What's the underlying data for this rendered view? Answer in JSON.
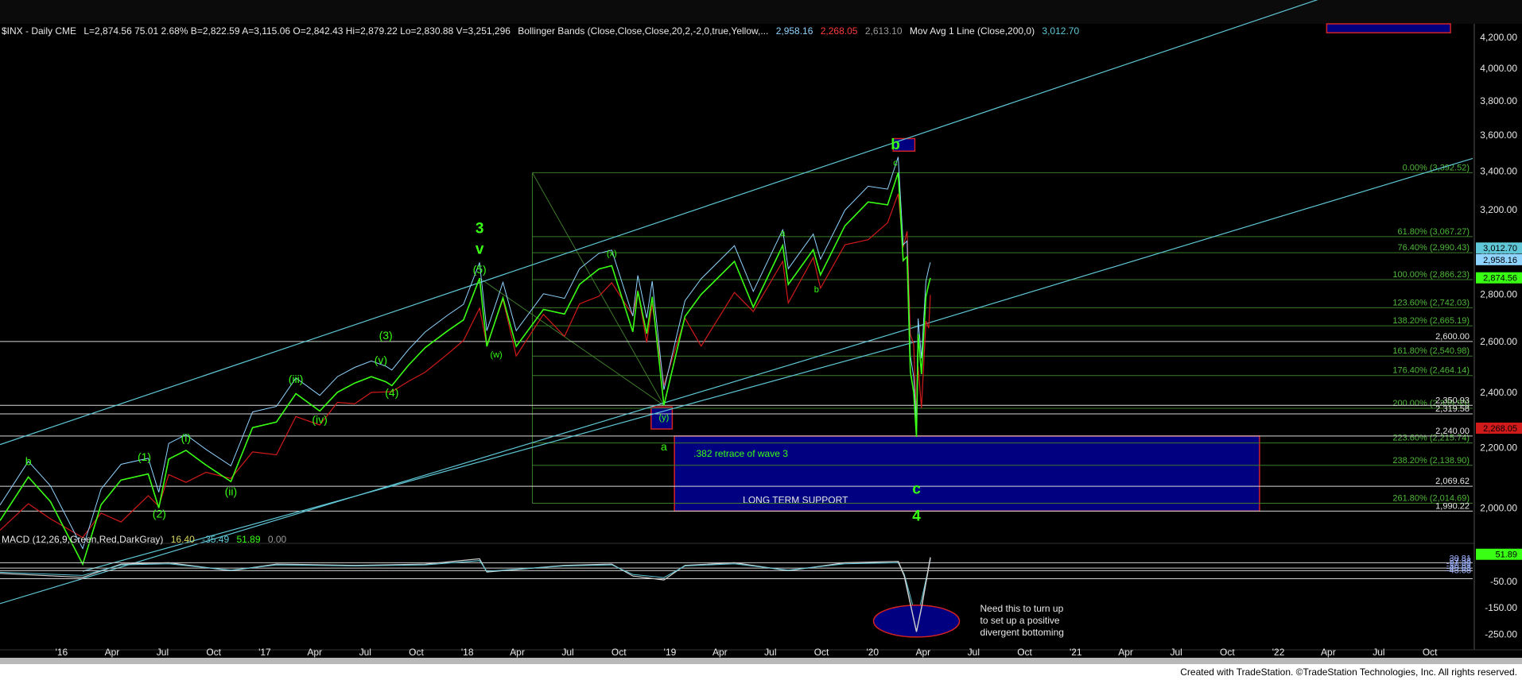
{
  "header": {
    "symbol": "$INX - Daily  CME",
    "quote": "L=2,874.56  75.01  2.68%  B=2,822.59  A=3,115.06  O=2,842.43  Hi=2,879.22  Lo=2,830.88  V=3,251,296",
    "bb_label": "Bollinger Bands (Close,Close,Close,20,2,-2,0,true,Yellow,...",
    "bb_values": [
      "2,958.16",
      "2,268.05",
      "2,613.10"
    ],
    "ma_label": "Mov Avg 1 Line (Close,200,0)",
    "ma_value": "3,012.70"
  },
  "macd_header": {
    "label": "MACD (12,26,9,Green,Red,DarkGray)",
    "values": [
      "16.40",
      "-35.49",
      "51.89",
      "0.00"
    ]
  },
  "footer": "Created with TradeStation. ©TradeStation Technologies, Inc. All rights reserved.",
  "colors": {
    "price": "#39ff14",
    "bb": "#8fd3ff",
    "ma_red": "#d11a1a",
    "channel": "#5fc7d6",
    "fib": "#3d7a2a",
    "box_fill": "#000080",
    "box_border": "#d22222",
    "label_green": "#39ff14",
    "axis_text": "#e8e8e8"
  },
  "chart_data": [
    {
      "type": "line",
      "title": "$INX - Daily",
      "y_axis": {
        "ticks": [
          2000,
          2200,
          2400,
          2600,
          2800,
          3000,
          3200,
          3400,
          3600,
          3800,
          4000,
          4200
        ],
        "tick_labels": [
          "2,000.00",
          "2,200.00",
          "2,400.00",
          "2,600.00",
          "2,800.00",
          "3,000.00",
          "3,200.00",
          "3,400.00",
          "3,600.00",
          "3,800.00",
          "4,000.00",
          "4,200.00"
        ],
        "ylim": [
          1920,
          4290
        ],
        "scale": "log"
      },
      "x_axis": {
        "tick_labels": [
          "'16",
          "Apr",
          "Jul",
          "Oct",
          "'17",
          "Apr",
          "Jul",
          "Oct",
          "'18",
          "Apr",
          "Jul",
          "Oct",
          "'19",
          "Apr",
          "Jul",
          "Oct",
          "'20",
          "Apr",
          "Jul",
          "Oct",
          "'21",
          "Apr",
          "Jul",
          "Oct",
          "'22",
          "Apr",
          "Jul",
          "Oct"
        ],
        "tick_dates": [
          "2016-01",
          "2016-04",
          "2016-07",
          "2016-10",
          "2017-01",
          "2017-04",
          "2017-07",
          "2017-10",
          "2018-01",
          "2018-04",
          "2018-07",
          "2018-10",
          "2019-01",
          "2019-04",
          "2019-07",
          "2019-10",
          "2020-01",
          "2020-04",
          "2020-07",
          "2020-10",
          "2021-01",
          "2021-04",
          "2021-07",
          "2021-10",
          "2022-01",
          "2022-04",
          "2022-07",
          "2022-10"
        ],
        "xlim": [
          "2015-09-15",
          "2022-12-20"
        ]
      },
      "series": [
        {
          "name": "$INX",
          "points": [
            [
              "2015-09-15",
              1960
            ],
            [
              "2015-11-05",
              2100
            ],
            [
              "2015-12-15",
              2020
            ],
            [
              "2016-02-11",
              1830
            ],
            [
              "2016-03-15",
              2010
            ],
            [
              "2016-04-20",
              2090
            ],
            [
              "2016-06-08",
              2110
            ],
            [
              "2016-06-27",
              2000
            ],
            [
              "2016-07-15",
              2160
            ],
            [
              "2016-08-15",
              2190
            ],
            [
              "2016-09-20",
              2140
            ],
            [
              "2016-11-04",
              2085
            ],
            [
              "2016-12-13",
              2270
            ],
            [
              "2017-01-25",
              2290
            ],
            [
              "2017-03-01",
              2395
            ],
            [
              "2017-04-13",
              2330
            ],
            [
              "2017-05-15",
              2400
            ],
            [
              "2017-06-15",
              2435
            ],
            [
              "2017-07-15",
              2460
            ],
            [
              "2017-08-10",
              2440
            ],
            [
              "2017-08-21",
              2425
            ],
            [
              "2017-09-20",
              2505
            ],
            [
              "2017-10-20",
              2575
            ],
            [
              "2017-11-30",
              2645
            ],
            [
              "2017-12-28",
              2690
            ],
            [
              "2018-01-26",
              2873
            ],
            [
              "2018-02-08",
              2580
            ],
            [
              "2018-03-09",
              2785
            ],
            [
              "2018-04-02",
              2580
            ],
            [
              "2018-05-21",
              2735
            ],
            [
              "2018-06-28",
              2715
            ],
            [
              "2018-07-25",
              2845
            ],
            [
              "2018-08-29",
              2915
            ],
            [
              "2018-09-21",
              2930
            ],
            [
              "2018-10-29",
              2640
            ],
            [
              "2018-11-07",
              2815
            ],
            [
              "2018-11-23",
              2632
            ],
            [
              "2018-12-03",
              2790
            ],
            [
              "2018-12-24",
              2351
            ],
            [
              "2019-01-31",
              2705
            ],
            [
              "2019-03-01",
              2800
            ],
            [
              "2019-04-30",
              2950
            ],
            [
              "2019-06-03",
              2745
            ],
            [
              "2019-07-26",
              3025
            ],
            [
              "2019-08-05",
              2845
            ],
            [
              "2019-09-19",
              3005
            ],
            [
              "2019-10-02",
              2888
            ],
            [
              "2019-11-15",
              3120
            ],
            [
              "2019-12-27",
              3240
            ],
            [
              "2020-01-31",
              3225
            ],
            [
              "2020-02-19",
              3393
            ],
            [
              "2020-02-28",
              2954
            ],
            [
              "2020-03-06",
              2972
            ],
            [
              "2020-03-12",
              2480
            ],
            [
              "2020-03-18",
              2400
            ],
            [
              "2020-03-23",
              2237
            ],
            [
              "2020-03-26",
              2630
            ],
            [
              "2020-04-01",
              2470
            ],
            [
              "2020-04-09",
              2790
            ],
            [
              "2020-04-14",
              2846
            ],
            [
              "2020-04-17",
              2874
            ]
          ]
        }
      ],
      "horizontal_lines": [
        {
          "label": "2,600.00",
          "value": 2600
        },
        {
          "label": "2,350.93",
          "value": 2350.93
        },
        {
          "label": "2,319.58",
          "value": 2319.58
        },
        {
          "label": "2,240.00",
          "value": 2240
        },
        {
          "label": "2,069.62",
          "value": 2069.62
        },
        {
          "label": "1,990.22",
          "value": 1990.22
        }
      ],
      "fib_levels": [
        {
          "label": "0.00% (3,392.52)",
          "value": 3392.52
        },
        {
          "label": "61.80% (3,067.27)",
          "value": 3067.27
        },
        {
          "label": "76.40% (2,990.43)",
          "value": 2990.43
        },
        {
          "label": "100.00% (2,866.23)",
          "value": 2866.23
        },
        {
          "label": "123.60% (2,742.03)",
          "value": 2742.03
        },
        {
          "label": "138.20% (2,665.19)",
          "value": 2665.19
        },
        {
          "label": "161.80% (2,540.98)",
          "value": 2540.98
        },
        {
          "label": "176.40% (2,464.14)",
          "value": 2464.14
        },
        {
          "label": "200.00% (2,339.93)",
          "value": 2339.93
        },
        {
          "label": "223.60% (2,215.74)",
          "value": 2215.74
        },
        {
          "label": "238.20% (2,138.90)",
          "value": 2138.9
        },
        {
          "label": "261.80% (2,014.69)",
          "value": 2014.69
        }
      ],
      "price_tags": [
        {
          "text": "3,012.70",
          "value": 3012.7,
          "bg": "#5fc7d6"
        },
        {
          "text": "2,958.16",
          "value": 2958.16,
          "bg": "#8fd3ff"
        },
        {
          "text": "2,874.56",
          "value": 2874.56,
          "bg": "#39ff14"
        },
        {
          "text": "2,268.05",
          "value": 2268.05,
          "bg": "#d11a1a"
        }
      ],
      "boxes": [
        {
          "name": "long-term-support",
          "x": [
            "2019-01-12",
            "2021-12-01"
          ],
          "y": [
            1990.22,
            2240
          ],
          "label": "LONG TERM SUPPORT",
          "sublabel": ".382 retrace of wave 3"
        },
        {
          "name": "wave-b-target",
          "x": [
            "2020-02-10",
            "2020-03-20"
          ],
          "y": [
            3510,
            3580
          ]
        },
        {
          "name": "wave-y-box",
          "x": [
            "2018-12-01",
            "2019-01-08"
          ],
          "y": [
            2265,
            2345
          ]
        },
        {
          "name": "top-box",
          "x": [
            "2022-04-01",
            "2022-11-10"
          ],
          "y": [
            4230,
            4290
          ]
        }
      ],
      "wave_labels": [
        {
          "text": "b",
          "date": "2015-11-05",
          "value": 2140,
          "size": "m"
        },
        {
          "text": "(1)",
          "date": "2016-06-01",
          "value": 2155,
          "size": "m"
        },
        {
          "text": "(2)",
          "date": "2016-06-28",
          "value": 1970,
          "size": "m"
        },
        {
          "text": "(i)",
          "date": "2016-08-15",
          "value": 2220,
          "size": "m"
        },
        {
          "text": "(ii)",
          "date": "2016-11-04",
          "value": 2040,
          "size": "m"
        },
        {
          "text": "(iii)",
          "date": "2017-03-01",
          "value": 2435,
          "size": "m"
        },
        {
          "text": "(iv)",
          "date": "2017-04-13",
          "value": 2285,
          "size": "m"
        },
        {
          "text": "(v)",
          "date": "2017-08-01",
          "value": 2510,
          "size": "m"
        },
        {
          "text": "(3)",
          "date": "2017-08-10",
          "value": 2610,
          "size": "m"
        },
        {
          "text": "(4)",
          "date": "2017-08-21",
          "value": 2385,
          "size": "m"
        },
        {
          "text": "(5)",
          "date": "2018-01-26",
          "value": 2895,
          "size": "m"
        },
        {
          "text": "v",
          "date": "2018-01-26",
          "value": 2985,
          "size": "l"
        },
        {
          "text": "3",
          "date": "2018-01-26",
          "value": 3085,
          "size": "l"
        },
        {
          "text": "(w)",
          "date": "2018-02-25",
          "value": 2535,
          "size": "s"
        },
        {
          "text": "(x)",
          "date": "2018-09-21",
          "value": 2975,
          "size": "s"
        },
        {
          "text": "(y)",
          "date": "2018-12-24",
          "value": 2297,
          "size": "s"
        },
        {
          "text": "a",
          "date": "2018-12-24",
          "value": 2190,
          "size": "m"
        },
        {
          "text": "a",
          "date": "2019-07-26",
          "value": 3070,
          "size": "s"
        },
        {
          "text": "b",
          "date": "2019-09-25",
          "value": 2810,
          "size": "s"
        },
        {
          "text": "b",
          "date": "2020-02-14",
          "value": 3520,
          "size": "l"
        },
        {
          "text": "c",
          "date": "2020-02-14",
          "value": 3430,
          "size": "s"
        },
        {
          "text": "c",
          "date": "2020-03-23",
          "value": 2045,
          "size": "l"
        },
        {
          "text": "4",
          "date": "2020-03-23",
          "value": 1960,
          "size": "l"
        }
      ]
    },
    {
      "type": "line",
      "title": "MACD (12,26,9,Green,Red,DarkGray)",
      "y_axis": {
        "tick_labels": [
          "-50.00",
          "-150.00",
          "-250.00"
        ],
        "ticks": [
          -50,
          -150,
          -250
        ],
        "ylim": [
          -290,
          75
        ]
      },
      "overlapping_labels": [
        "30.81",
        "27.38",
        "-27.38",
        "-30.81",
        "-40.08",
        "-43.68"
      ],
      "tag": {
        "text": "51.89",
        "value": 51.89
      },
      "series": [
        {
          "name": "MACD",
          "points": [
            [
              "2015-09-15",
              -20
            ],
            [
              "2016-02-11",
              -35
            ],
            [
              "2016-04-20",
              15
            ],
            [
              "2016-07-15",
              20
            ],
            [
              "2016-11-04",
              -10
            ],
            [
              "2017-01-25",
              15
            ],
            [
              "2017-06-15",
              10
            ],
            [
              "2017-10-20",
              15
            ],
            [
              "2018-01-26",
              35
            ],
            [
              "2018-02-08",
              -15
            ],
            [
              "2018-06-28",
              10
            ],
            [
              "2018-09-21",
              15
            ],
            [
              "2018-10-29",
              -30
            ],
            [
              "2018-12-24",
              -45
            ],
            [
              "2019-01-31",
              10
            ],
            [
              "2019-04-30",
              20
            ],
            [
              "2019-08-05",
              -10
            ],
            [
              "2019-11-15",
              20
            ],
            [
              "2020-02-19",
              25
            ],
            [
              "2020-03-01",
              -30
            ],
            [
              "2020-03-23",
              -240
            ],
            [
              "2020-04-01",
              -150
            ],
            [
              "2020-04-17",
              40
            ]
          ]
        }
      ]
    }
  ],
  "annotations": {
    "macd_note": [
      "Need this to turn up",
      "to set up a positive",
      "divergent bottoming"
    ]
  }
}
